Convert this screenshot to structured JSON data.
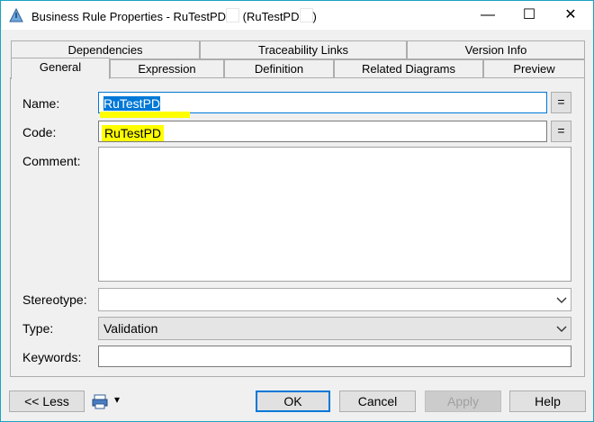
{
  "window": {
    "title_prefix": "Business Rule Properties - RuTestPD",
    "title_middle": " (RuTestPD",
    "title_suffix": ")",
    "minimize_glyph": "—",
    "maximize_glyph": "☐",
    "close_glyph": "✕"
  },
  "tabs_back": [
    "Dependencies",
    "Traceability Links",
    "Version Info"
  ],
  "tabs_front": [
    "General",
    "Expression",
    "Definition",
    "Related Diagrams",
    "Preview"
  ],
  "form": {
    "name_label": "Name:",
    "name_value": "RuTestPD",
    "code_label": "Code:",
    "code_value": "RuTestPD",
    "comment_label": "Comment:",
    "comment_value": "",
    "stereotype_label": "Stereotype:",
    "stereotype_value": "",
    "type_label": "Type:",
    "type_value": "Validation",
    "keywords_label": "Keywords:",
    "keywords_value": "",
    "eq_glyph": "="
  },
  "footer": {
    "less_label": "<< Less",
    "ok_label": "OK",
    "cancel_label": "Cancel",
    "apply_label": "Apply",
    "help_label": "Help",
    "dropdown_glyph": "▾"
  },
  "colors": {
    "accent": "#0078d7",
    "highlight": "#ffff00",
    "border": "#18a2c4"
  }
}
